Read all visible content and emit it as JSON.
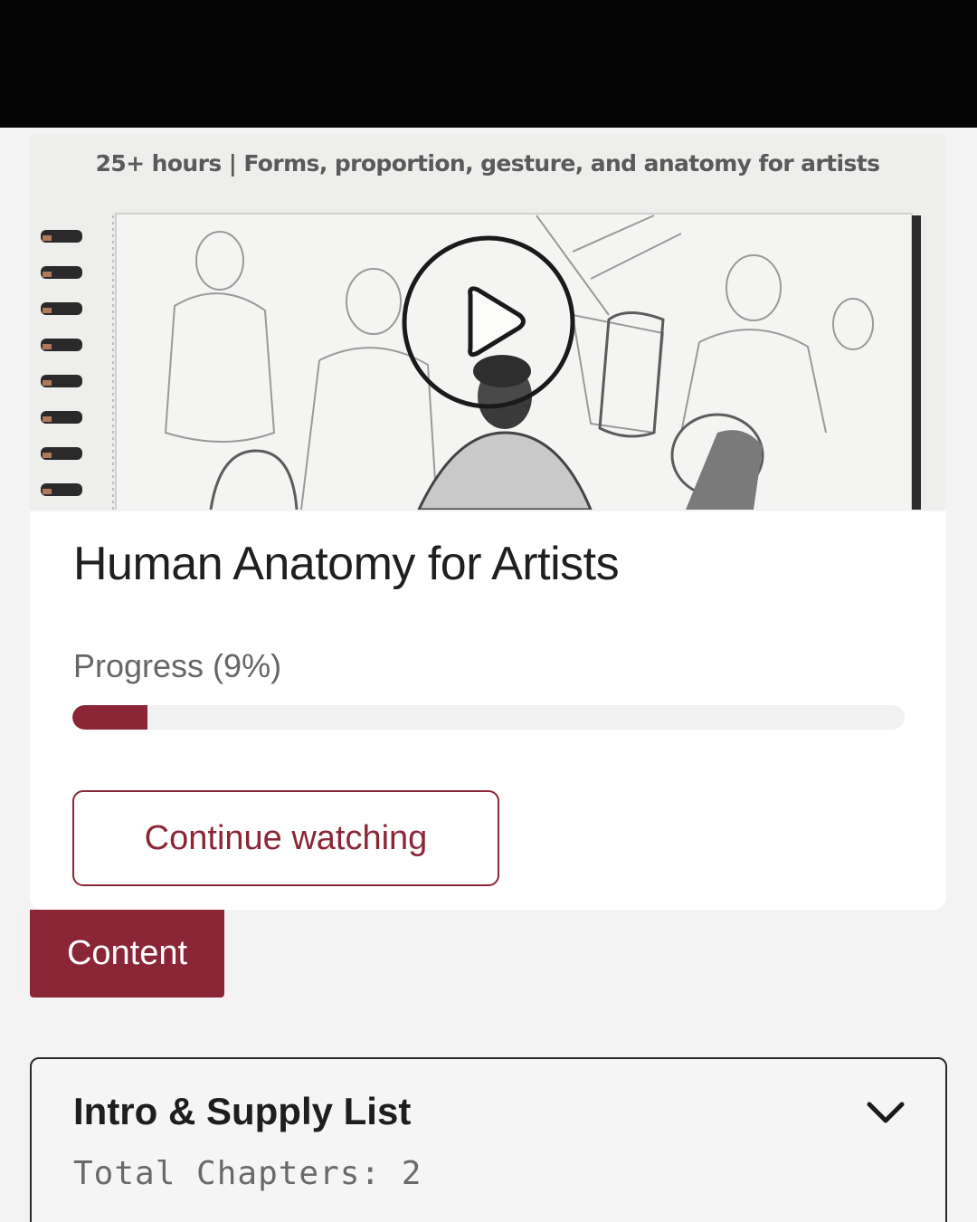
{
  "hero": {
    "subtitle": "25+ hours | Forms, proportion, gesture, and anatomy for artists",
    "play_icon": "play-circle-icon"
  },
  "course": {
    "title": "Human Anatomy for Artists",
    "progress_label": "Progress (9%)",
    "progress_percent": 9,
    "continue_label": "Continue watching"
  },
  "tabs": {
    "content_label": "Content"
  },
  "sections": [
    {
      "title": "Intro & Supply List",
      "meta": "Total Chapters: 2",
      "icon": "chevron-down-icon"
    }
  ],
  "colors": {
    "accent": "#8b2636",
    "top_bar": "#050505",
    "background": "#f3f3f3"
  }
}
